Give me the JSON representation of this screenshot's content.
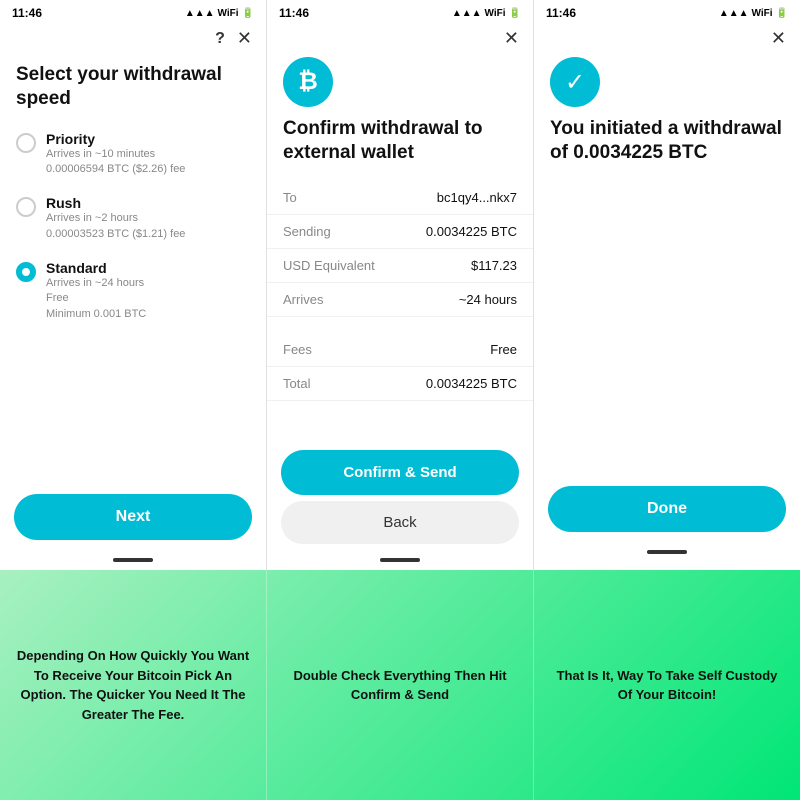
{
  "screens": [
    {
      "status_time": "11:46",
      "title": "Select your withdrawal speed",
      "options": [
        {
          "id": "priority",
          "label": "Priority",
          "sub1": "Arrives in ~10 minutes",
          "sub2": "0.00006594 BTC ($2.26) fee",
          "selected": false
        },
        {
          "id": "rush",
          "label": "Rush",
          "sub1": "Arrives in ~2 hours",
          "sub2": "0.00003523 BTC ($1.21) fee",
          "selected": false
        },
        {
          "id": "standard",
          "label": "Standard",
          "sub1": "Arrives in ~24 hours",
          "sub2": "Free",
          "sub3": "Minimum 0.001 BTC",
          "selected": true
        }
      ],
      "next_btn": "Next",
      "caption": "Depending On How Quickly You Want To Receive Your Bitcoin Pick An Option. The Quicker You Need It The Greater The Fee."
    },
    {
      "status_time": "11:46",
      "title": "Confirm withdrawal to external wallet",
      "details": [
        {
          "label": "To",
          "value": "bc1qy4...nkx7"
        },
        {
          "label": "Sending",
          "value": "0.0034225 BTC"
        },
        {
          "label": "USD Equivalent",
          "value": "$117.23"
        },
        {
          "label": "Arrives",
          "value": "~24 hours"
        }
      ],
      "fees": [
        {
          "label": "Fees",
          "value": "Free"
        },
        {
          "label": "Total",
          "value": "0.0034225 BTC"
        }
      ],
      "confirm_btn": "Confirm & Send",
      "back_btn": "Back",
      "caption": "Double Check Everything Then Hit Confirm & Send"
    },
    {
      "status_time": "11:46",
      "title": "You initiated a withdrawal of 0.0034225 BTC",
      "done_btn": "Done",
      "caption": "That Is It, Way To Take Self Custody Of Your Bitcoin!"
    }
  ]
}
